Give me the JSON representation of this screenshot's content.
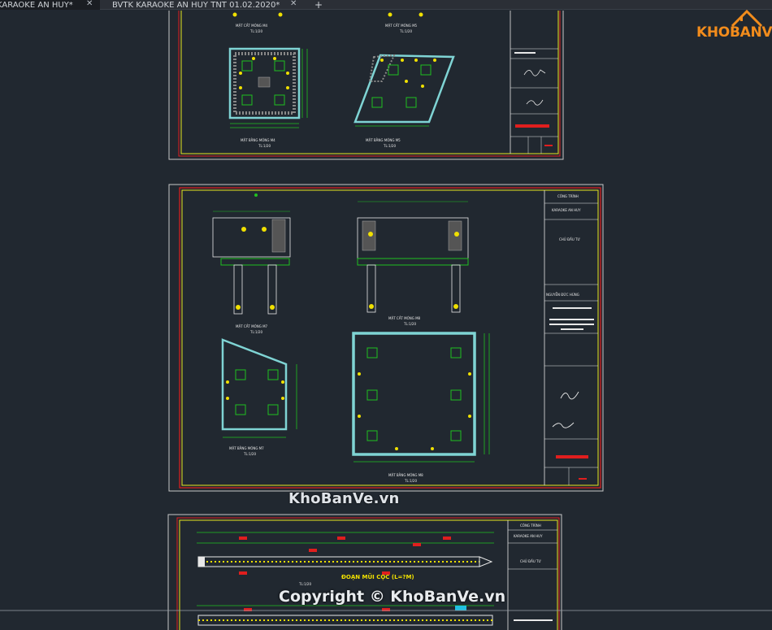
{
  "tabs": [
    {
      "label": "KARAOKE AN HUY*",
      "active": true
    },
    {
      "label": "BVTK KARAOKE AN HUY TNT 01.02.2020*",
      "active": false
    }
  ],
  "logo": {
    "text": "KHOBANVE"
  },
  "watermarks": {
    "site": "KhoBanVe.vn",
    "copyright": "Copyright © KhoBanVe.vn"
  },
  "sheet_top": {
    "labels": [
      "MẶT CẮT MÓNG M4",
      "MẶT CẮT MÓNG M5",
      "MẶT BẰNG MÓNG M4",
      "MẶT BẰNG MÓNG M5"
    ],
    "scales": [
      "TL:1/20",
      "TL:1/20",
      "TL:1/20",
      "TL:1/20"
    ]
  },
  "sheet_mid": {
    "labels": [
      "MẶT CẮT MÓNG M7",
      "MẶT CẮT MÓNG M8",
      "MẶT BẰNG MÓNG M7",
      "MẶT BẰNG MÓNG M8"
    ],
    "scales": [
      "TL:1/20",
      "TL:1/20",
      "TL:1/20",
      "TL:1/20"
    ],
    "titleblock": {
      "owner_label": "CHỦ ĐẦU TƯ",
      "project": "KARAOKE AN HUY",
      "person": "NGUYỄN ĐỨC HÙNG",
      "heading": "CÔNG TRÌNH"
    }
  },
  "sheet_bottom": {
    "label": "ĐOẠN MŨI CỌC (L=?M)",
    "scale": "TL:1/20",
    "titleblock": {
      "heading": "CÔNG TRÌNH",
      "project": "KARAOKE AN HUY",
      "owner_label": "CHỦ ĐẦU TƯ"
    }
  },
  "colors": {
    "background": "#212830",
    "sheet_border": "#e8e8e8",
    "frame_red": "#e01e1e",
    "frame_yellow": "#e6e620",
    "cyan": "#7fd4d4",
    "green": "#20c020",
    "yellow_dot": "#f0e000",
    "logo_orange": "#f28c1c"
  }
}
